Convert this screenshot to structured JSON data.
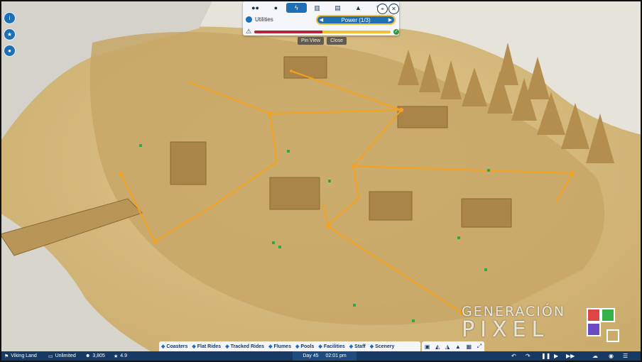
{
  "sidebar": {
    "icons": [
      "guests-icon",
      "park-info-icon",
      "notifications-icon"
    ]
  },
  "panel": {
    "tabs": [
      "guests-tab-icon",
      "staff-tab-icon",
      "utilities-tab-icon",
      "building-tab-icon",
      "chart-tab-icon",
      "mountain-tab-icon",
      "wrench-tab-icon"
    ],
    "active_tab": 2,
    "section_label": "Utilities",
    "selector_value": "Power (1/3)",
    "power_bar_fill": 0.5,
    "pin_view_label": "Pin View",
    "close_label": "Close"
  },
  "categories": [
    {
      "icon": "coaster-icon",
      "label": "Coasters"
    },
    {
      "icon": "flat-ride-icon",
      "label": "Flat Rides"
    },
    {
      "icon": "tracked-ride-icon",
      "label": "Tracked Rides"
    },
    {
      "icon": "flume-icon",
      "label": "Flumes"
    },
    {
      "icon": "pool-icon",
      "label": "Pools"
    },
    {
      "icon": "facilities-icon",
      "label": "Facilities"
    },
    {
      "icon": "staff-icon",
      "label": "Staff"
    },
    {
      "icon": "scenery-icon",
      "label": "Scenery"
    }
  ],
  "status": {
    "park_name": "Viking Land",
    "money": "Unlimited",
    "guests": "3,805",
    "rating": "4.9",
    "day": "Day 45",
    "time": "02:01 pm"
  },
  "watermark": {
    "top": "GENERACIÓN",
    "bottom": "PIXEL"
  },
  "colors": {
    "accent": "#1f6fb5",
    "power_line": "#f5a11d",
    "bar_dark": "#163a63",
    "warning": "#b3263a",
    "highlight": "#f2c037"
  }
}
